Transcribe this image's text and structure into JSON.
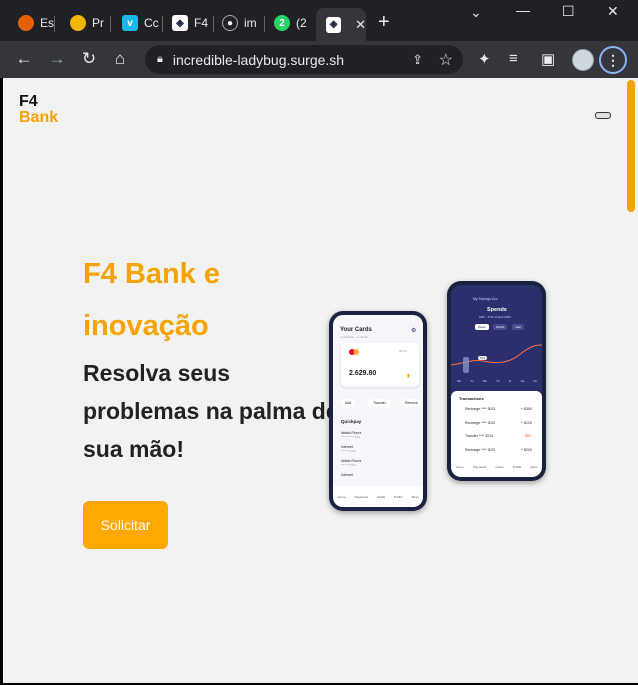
{
  "browser": {
    "tabs": [
      {
        "label": "Es",
        "icon": "firefox-icon",
        "color": "#e66000"
      },
      {
        "label": "Pr",
        "icon": "pr-icon",
        "color": "#f2b600"
      },
      {
        "label": "Cc",
        "icon": "vimeo-icon",
        "color": "#1ab7ea"
      },
      {
        "label": "F4",
        "icon": "f4-bank-icon",
        "color": "#ffffff"
      },
      {
        "label": "im",
        "icon": "github-icon",
        "color": "#ffffff"
      },
      {
        "label": "(2",
        "icon": "whatsapp-icon",
        "color": "#25d366"
      },
      {
        "label": "",
        "icon": "f4-bank-icon",
        "color": "#ffffff",
        "active": true
      }
    ],
    "whatsapp_badge": "2",
    "url": "incredible-ladybug.surge.sh"
  },
  "page": {
    "logo_line1": "F4",
    "logo_line2": "Bank",
    "hero_title": "F4 Bank e inovação",
    "hero_subtitle": "Resolva seus problemas na palma de sua mão!",
    "cta_label": "Solicitar",
    "accent_color": "#f5a300"
  },
  "phone_left": {
    "title": "Your Cards",
    "subtitle": "2 physical + 1 virtual",
    "card_number": "00.03",
    "balance": "2.629.80",
    "actions": [
      "Add",
      "Transfer",
      "Remove"
    ],
    "section": "Quickpay",
    "contacts": [
      {
        "name": "Iddido Florez",
        "sub": "**** **** **** 4291"
      },
      {
        "name": "Internet",
        "sub": "**** **** 2022"
      },
      {
        "name": "Iddido Florez",
        "sub": "**** **** 8291"
      },
      {
        "name": "Internet",
        "sub": ""
      }
    ],
    "nav": [
      "Home",
      "Payments",
      "Cards",
      "Profile",
      "More"
    ]
  },
  "phone_right": {
    "header": "My Savings Acc",
    "title": "Spends",
    "range": "18th - 17th of April 2022",
    "filters": [
      "Week",
      "Month",
      "Year"
    ],
    "point_label": "541",
    "days": [
      "Mo",
      "Tu",
      "We",
      "Th",
      "Fr",
      "Sa",
      "Su"
    ],
    "section": "Transactions",
    "transactions": [
      {
        "name": "Recharge **** 3022",
        "amount": "+ $300"
      },
      {
        "name": "Recharge **** 3022",
        "amount": "+ $120"
      },
      {
        "name": "Transfer **** 3014",
        "amount": "- $50"
      },
      {
        "name": "Recharge **** 3022",
        "amount": "+ $200"
      }
    ],
    "nav": [
      "Home",
      "Payments",
      "Cards",
      "Profile",
      "More"
    ]
  }
}
